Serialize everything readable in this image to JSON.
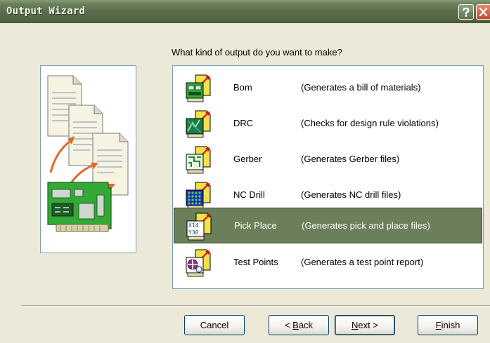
{
  "window": {
    "title": "Output Wizard"
  },
  "titlebar_buttons": {
    "help_icon": "question-mark",
    "close_icon": "x-mark"
  },
  "prompt": "What kind of output do you want to make?",
  "outputs": [
    {
      "name": "Bom",
      "description": "(Generates a bill of materials)",
      "icon": "bom-icon",
      "selected": false
    },
    {
      "name": "DRC",
      "description": "(Checks for design rule violations)",
      "icon": "drc-icon",
      "selected": false
    },
    {
      "name": "Gerber",
      "description": "(Generates Gerber files)",
      "icon": "gerber-icon",
      "selected": false
    },
    {
      "name": "NC Drill",
      "description": "(Generates NC drill files)",
      "icon": "nc-drill-icon",
      "selected": false
    },
    {
      "name": "Pick Place",
      "description": "(Generates pick and place files)",
      "icon": "pick-place-icon",
      "selected": true
    },
    {
      "name": "Test Points",
      "description": "(Generates a test point report)",
      "icon": "test-points-icon",
      "selected": false
    }
  ],
  "buttons": {
    "cancel": {
      "label": "Cancel"
    },
    "back": {
      "prefix": "< ",
      "mnemonic": "B",
      "rest": "ack"
    },
    "next": {
      "mnemonic": "N",
      "rest": "ext >"
    },
    "finish": {
      "mnemonic": "F",
      "rest": "inish"
    }
  },
  "colors": {
    "titlebar": "#5c6f4d",
    "selection": "#6b7f5a",
    "dialog_bg": "#ece9d8",
    "panel_border": "#7f9db9"
  }
}
